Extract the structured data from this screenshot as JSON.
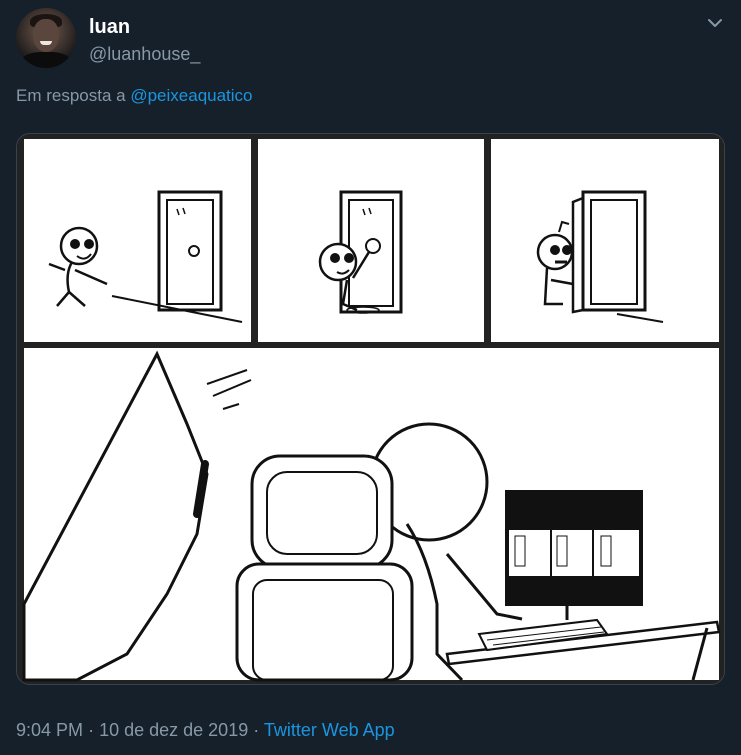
{
  "tweet": {
    "name": "luan",
    "handle": "@luanhouse_",
    "reply_prefix": "Em resposta a",
    "reply_to": "@peixeaquatico",
    "time": "9:04 PM",
    "separator": "·",
    "date": "10 de dez de 2019",
    "source": "Twitter Web App"
  },
  "icons": {
    "menu": "chevron-down-icon",
    "avatar": "user-avatar"
  },
  "colors": {
    "background": "#15202b",
    "secondary_text": "#8899a6",
    "link": "#1b95e0"
  }
}
